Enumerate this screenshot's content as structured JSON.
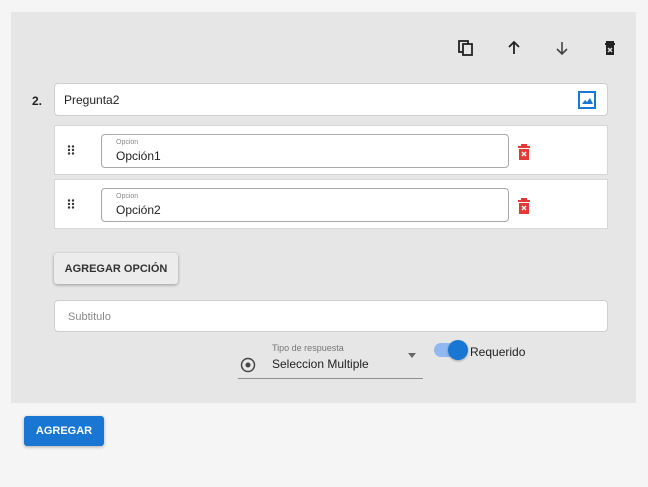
{
  "question": {
    "number": "2.",
    "title_value": "Pregunta2",
    "options": [
      {
        "label": "Opcion",
        "value": "Opción1"
      },
      {
        "label": "Opcion",
        "value": "Opción2"
      }
    ],
    "add_option_label": "AGREGAR OPCIÓN",
    "subtitle_placeholder": "Subtitulo",
    "response_type": {
      "label": "Tipo de respuesta",
      "value": "Seleccion Multiple"
    },
    "required": {
      "label": "Requerido",
      "on": true
    }
  },
  "toolbar": {
    "icons": [
      "copy-icon",
      "arrow-up-icon",
      "arrow-down-icon",
      "delete-icon"
    ]
  },
  "footer": {
    "add_label": "AGREGAR"
  },
  "colors": {
    "accent": "#1976d2",
    "danger": "#e53935",
    "card_bg": "#e6e6e6"
  }
}
